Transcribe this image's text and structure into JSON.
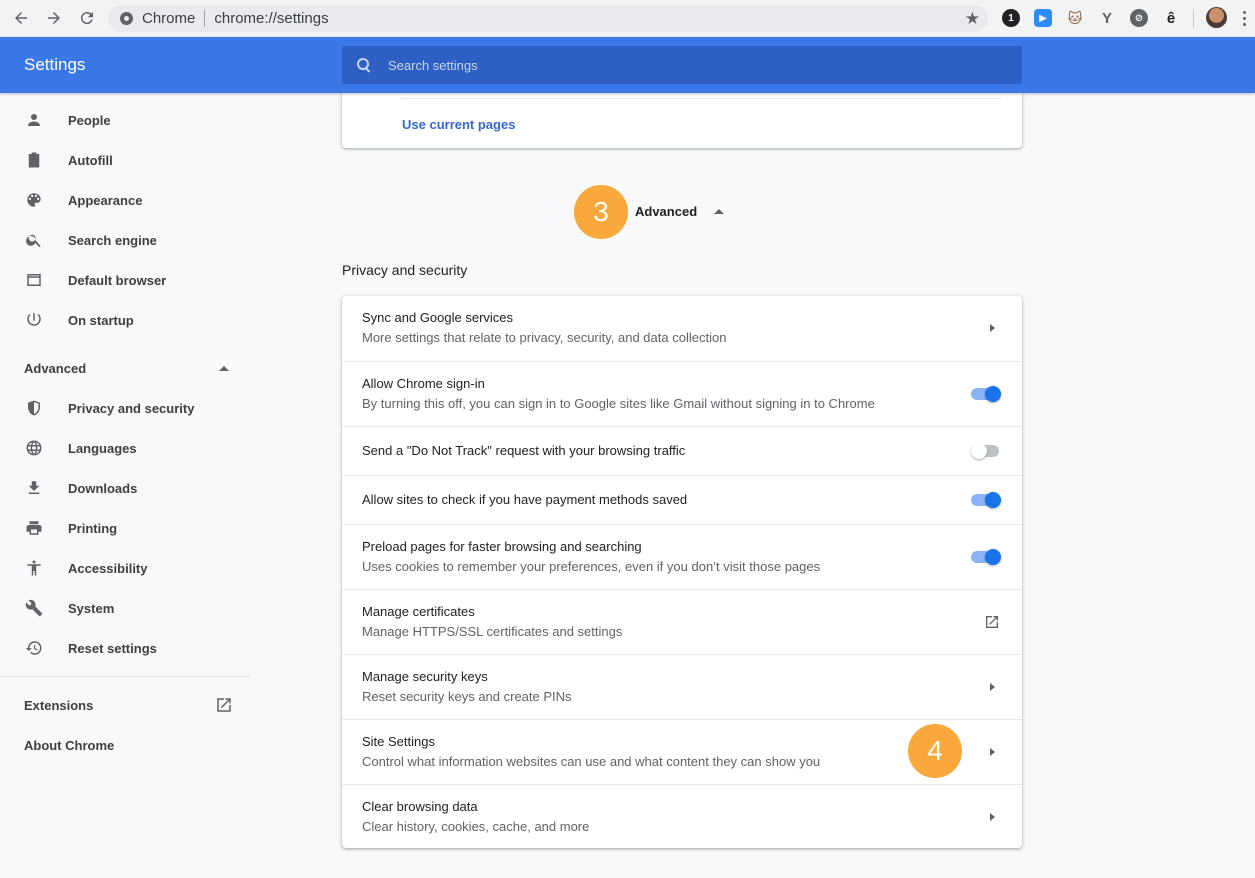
{
  "browser": {
    "address_chip": "Chrome",
    "url": "chrome://settings"
  },
  "header": {
    "title": "Settings",
    "search_placeholder": "Search settings"
  },
  "sidebar": {
    "items": [
      {
        "label": "People",
        "icon": "person-icon"
      },
      {
        "label": "Autofill",
        "icon": "clipboard-icon"
      },
      {
        "label": "Appearance",
        "icon": "palette-icon"
      },
      {
        "label": "Search engine",
        "icon": "search-icon"
      },
      {
        "label": "Default browser",
        "icon": "browser-window-icon"
      },
      {
        "label": "On startup",
        "icon": "power-icon"
      }
    ],
    "advanced_label": "Advanced",
    "advanced_items": [
      {
        "label": "Privacy and security",
        "icon": "shield-icon"
      },
      {
        "label": "Languages",
        "icon": "globe-icon"
      },
      {
        "label": "Downloads",
        "icon": "download-icon"
      },
      {
        "label": "Printing",
        "icon": "printer-icon"
      },
      {
        "label": "Accessibility",
        "icon": "accessibility-icon"
      },
      {
        "label": "System",
        "icon": "wrench-icon"
      },
      {
        "label": "Reset settings",
        "icon": "history-icon"
      }
    ],
    "extensions_label": "Extensions",
    "about_label": "About Chrome"
  },
  "main": {
    "use_current_pages": "Use current pages",
    "advanced_label": "Advanced",
    "badges": [
      "3",
      "4"
    ],
    "privacy_section_title": "Privacy and security",
    "rows": [
      {
        "title": "Sync and Google services",
        "subtitle": "More settings that relate to privacy, security, and data collection",
        "control": "arrow"
      },
      {
        "title": "Allow Chrome sign-in",
        "subtitle": "By turning this off, you can sign in to Google sites like Gmail without signing in to Chrome",
        "control": "toggle-on"
      },
      {
        "title": "Send a \"Do Not Track\" request with your browsing traffic",
        "subtitle": "",
        "control": "toggle-off"
      },
      {
        "title": "Allow sites to check if you have payment methods saved",
        "subtitle": "",
        "control": "toggle-on"
      },
      {
        "title": "Preload pages for faster browsing and searching",
        "subtitle": "Uses cookies to remember your preferences, even if you don’t visit those pages",
        "control": "toggle-on"
      },
      {
        "title": "Manage certificates",
        "subtitle": "Manage HTTPS/SSL certificates and settings",
        "control": "external-link"
      },
      {
        "title": "Manage security keys",
        "subtitle": "Reset security keys and create PINs",
        "control": "arrow"
      },
      {
        "title": "Site Settings",
        "subtitle": "Control what information websites can use and what content they can show you",
        "control": "arrow"
      },
      {
        "title": "Clear browsing data",
        "subtitle": "Clear history, cookies, cache, and more",
        "control": "arrow"
      }
    ]
  },
  "colors": {
    "header_blue": "#3b78e7",
    "accent_blue": "#1a73e8",
    "badge_orange": "#f9a93b"
  }
}
